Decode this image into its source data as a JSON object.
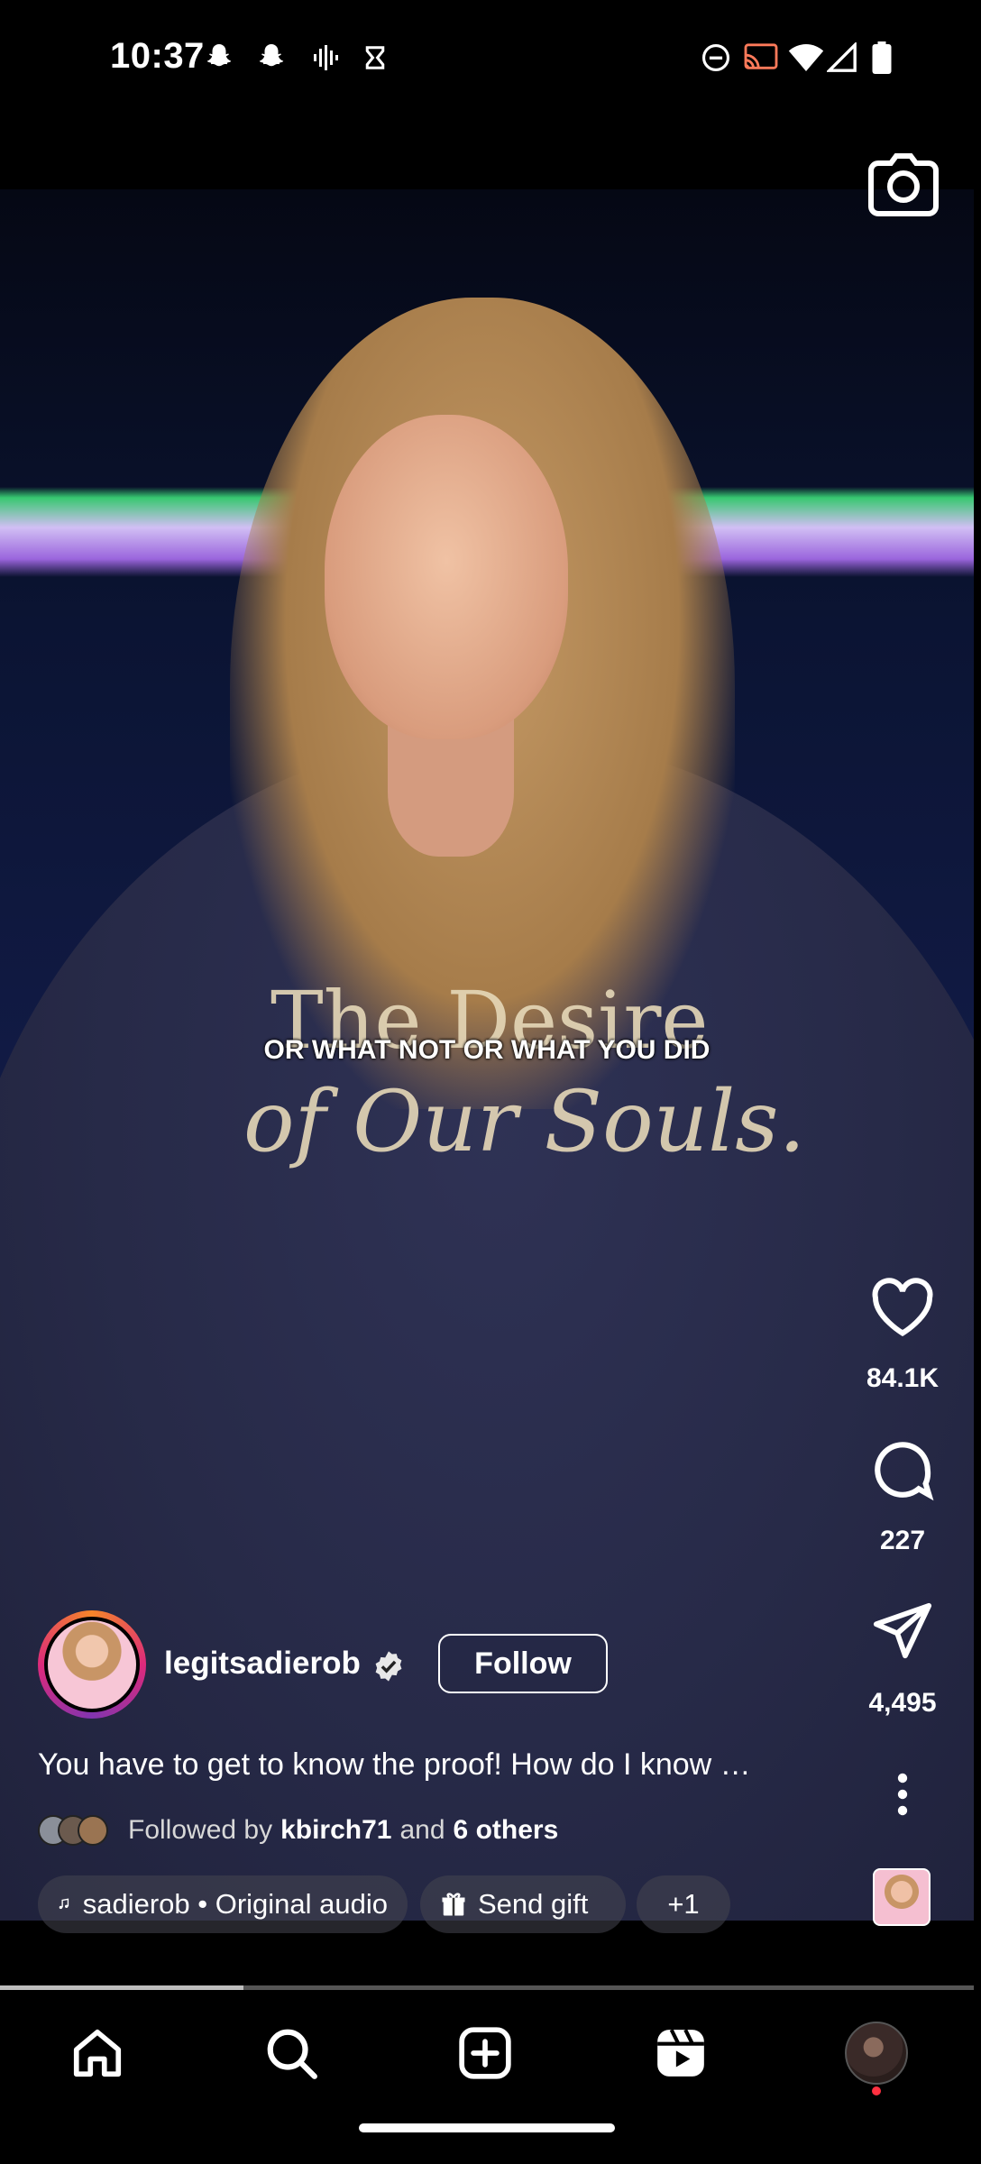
{
  "status_bar": {
    "time": "10:37",
    "left_icons": [
      "snapchat-icon",
      "snapchat-icon",
      "voice-icon",
      "timer-icon"
    ],
    "right_icons": [
      "dnd-icon",
      "cast-icon",
      "wifi-icon",
      "signal-icon",
      "battery-icon"
    ]
  },
  "header": {
    "camera_icon": "camera-icon"
  },
  "video": {
    "caption_overlay": "OR WHAT NOT OR WHAT YOU DID",
    "sweater_line1": "The Desire",
    "sweater_line2": "of Our Souls."
  },
  "actions": {
    "likes": "84.1K",
    "comments": "227",
    "shares": "4,495",
    "icons": [
      "heart-icon",
      "comment-icon",
      "send-icon",
      "more-icon"
    ]
  },
  "author": {
    "username": "legitsadierob",
    "verified": true,
    "follow_label": "Follow"
  },
  "post": {
    "caption": "You have to get to know the proof! How do I know …",
    "followed_by_prefix": "Followed by",
    "followed_by_user": "kbirch71",
    "followed_by_and": "and",
    "followed_by_others": "6 others"
  },
  "pills": {
    "audio": "sadierob • Original audio",
    "gift": "Send gift",
    "more": "+1"
  },
  "progress": {
    "fraction": 0.25
  },
  "nav": {
    "items": [
      "home-icon",
      "search-icon",
      "create-icon",
      "reels-icon",
      "profile-avatar"
    ]
  },
  "colors": {
    "background": "#000000",
    "text": "#ffffff",
    "notification_dot": "#ff3040"
  }
}
